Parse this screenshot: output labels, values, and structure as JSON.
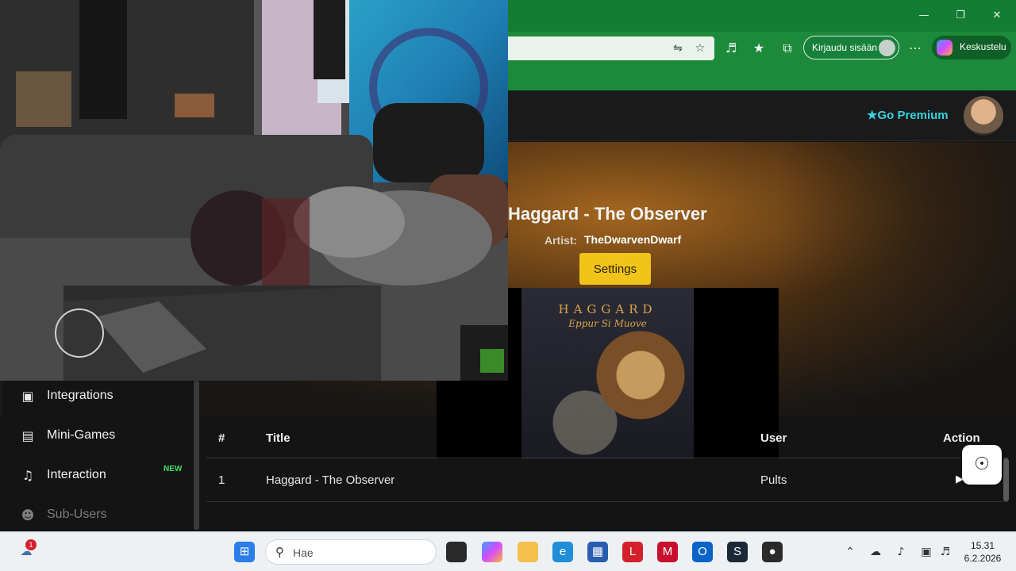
{
  "browser": {
    "signin_label": "Kirjaudu sisään",
    "copilot_label": "Keskustelu",
    "window_controls": [
      "minimize-icon",
      "restore-icon",
      "close-icon"
    ]
  },
  "header": {
    "premium_label": "Go Premium",
    "premium_icon": "star-icon",
    "premium_color": "#36d1e0"
  },
  "now_playing": {
    "title": "Haggard - The Observer",
    "artist_label": "Artist:",
    "artist": "TheDwarvenDwarf",
    "settings_label": "Settings",
    "album_band": "HAGGARD",
    "album_name": "Eppur Si Muove",
    "accent_color": "#f0c419"
  },
  "sidebar": {
    "items": [
      {
        "label": "Integrations",
        "icon": "integrations-icon"
      },
      {
        "label": "Mini-Games",
        "icon": "gamepad-icon"
      },
      {
        "label": "Interaction",
        "icon": "music-note-icon",
        "badge": "NEW"
      },
      {
        "label": "Sub-Users",
        "icon": "users-icon"
      }
    ]
  },
  "queue": {
    "columns": [
      "#",
      "Title",
      "User",
      "Action"
    ],
    "rows": [
      {
        "num": "1",
        "title": "Haggard - The Observer",
        "user": "Pults"
      }
    ]
  },
  "taskbar": {
    "search_placeholder": "Hae",
    "notification_count": "1",
    "time": "15.31",
    "date": "6.2.2026"
  }
}
